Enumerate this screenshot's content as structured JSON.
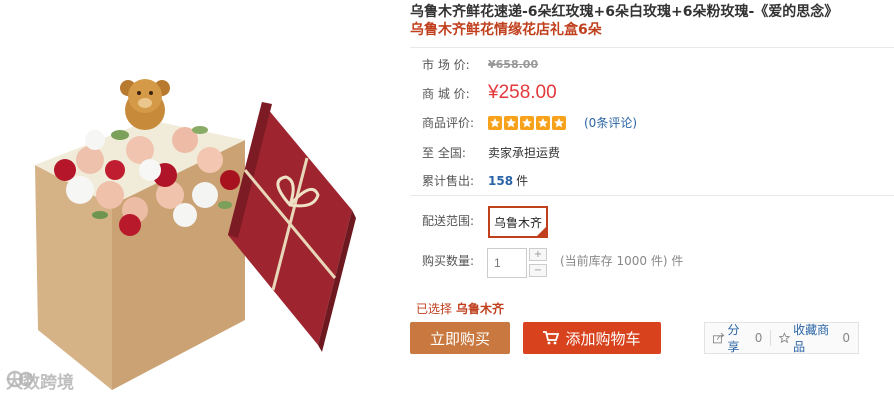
{
  "product": {
    "title": "乌鲁木齐鲜花速递-6朵红玫瑰+6朵白玫瑰+6朵粉玫瑰-《爱的思念》",
    "subtitle": "乌鲁木齐鲜花情缘花店礼盒6朵"
  },
  "pricing": {
    "market_label": "市 场 价:",
    "market_price": "¥658.00",
    "store_label": "商 城 价:",
    "store_price": "¥258.00"
  },
  "rating": {
    "label": "商品评价:",
    "stars": 5,
    "reviews": "(0条评论)"
  },
  "shipping": {
    "label": "至   全国:",
    "value": "卖家承担运费"
  },
  "sales": {
    "label": "累计售出:",
    "count": "158",
    "unit": "件"
  },
  "delivery": {
    "label": "配送范围:",
    "city": "乌鲁木齐"
  },
  "quantity": {
    "label": "购买数量:",
    "value": "1",
    "plus": "+",
    "minus": "−",
    "stock": "(当前库存 1000 件) 件"
  },
  "selection": {
    "prefix": "已选择",
    "value": "乌鲁木齐"
  },
  "actions": {
    "buy": "立即购买",
    "cart": "添加购物车"
  },
  "social": {
    "share_label": "分享",
    "share_count": "0",
    "fav_label": "收藏商品",
    "fav_count": "0"
  },
  "watermark": {
    "text": "大数跨境"
  },
  "colors": {
    "accent": "#c0401e",
    "price": "#e4393c",
    "buy_button": "#c9793f",
    "cart_button": "#d8421c",
    "link": "#2a64a6",
    "star": "#f7a21a"
  }
}
